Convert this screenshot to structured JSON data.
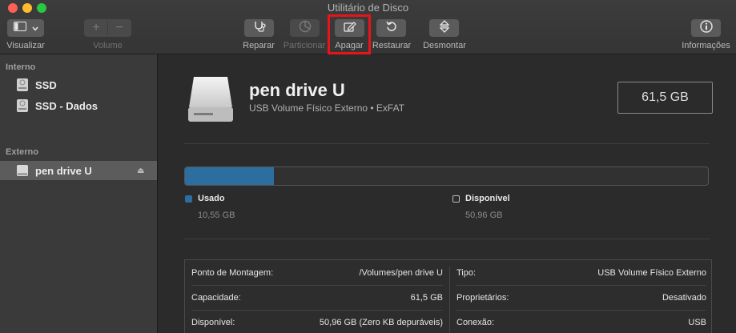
{
  "window": {
    "title": "Utilitário de Disco"
  },
  "toolbar": {
    "view_label": "Visualizar",
    "volume_label": "Volume",
    "volume_add_symbol": "+",
    "volume_remove_symbol": "−",
    "repair_label": "Reparar",
    "partition_label": "Particionar",
    "erase_label": "Apagar",
    "restore_label": "Restaurar",
    "unmount_label": "Desmontar",
    "info_label": "Informações",
    "highlight_color": "#e8141b"
  },
  "sidebar": {
    "internal_header": "Interno",
    "external_header": "Externo",
    "internal_items": [
      {
        "label": "SSD",
        "icon": "internal-disk-icon"
      },
      {
        "label": "SSD - Dados",
        "icon": "internal-disk-icon"
      }
    ],
    "external_items": [
      {
        "label": "pen drive U",
        "icon": "external-disk-icon",
        "selected": true,
        "eject_icon": "eject-icon"
      }
    ]
  },
  "drive": {
    "name": "pen drive U",
    "subtitle": "USB Volume Físico Externo • ExFAT",
    "size": "61,5 GB",
    "used_fraction": 0.17
  },
  "usage": {
    "used_label": "Usado",
    "used_value": "10,55 GB",
    "used_color": "#2c6e9e",
    "free_label": "Disponível",
    "free_value": "50,96 GB"
  },
  "info": {
    "left": [
      {
        "key": "Ponto de Montagem:",
        "value": "/Volumes/pen drive U"
      },
      {
        "key": "Capacidade:",
        "value": "61,5 GB"
      },
      {
        "key": "Disponível:",
        "value": "50,96 GB (Zero KB depuráveis)"
      }
    ],
    "right": [
      {
        "key": "Tipo:",
        "value": "USB Volume Físico Externo"
      },
      {
        "key": "Proprietários:",
        "value": "Desativado"
      },
      {
        "key": "Conexão:",
        "value": "USB"
      }
    ]
  }
}
